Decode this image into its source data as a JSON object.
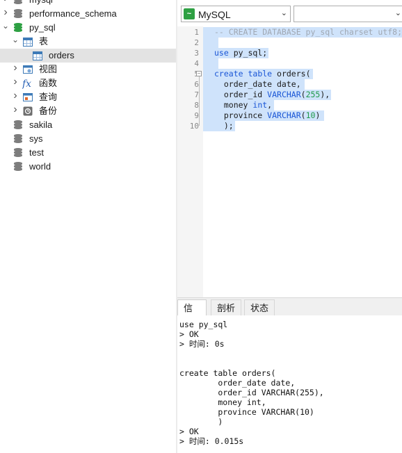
{
  "tree": {
    "items": [
      {
        "label": "mysql",
        "type": "db",
        "level": 1,
        "expanded": false
      },
      {
        "label": "performance_schema",
        "type": "db",
        "level": 1,
        "expanded": false
      },
      {
        "label": "py_sql",
        "type": "db-open",
        "level": 1,
        "expanded": true
      },
      {
        "label": "表",
        "type": "tables",
        "level": 2,
        "expanded": true
      },
      {
        "label": "orders",
        "type": "table",
        "level": 3,
        "selected": true
      },
      {
        "label": "视图",
        "type": "views",
        "level": 2,
        "expanded": false
      },
      {
        "label": "函数",
        "type": "functions",
        "level": 2,
        "expanded": false
      },
      {
        "label": "查询",
        "type": "queries",
        "level": 2,
        "expanded": false
      },
      {
        "label": "备份",
        "type": "backups",
        "level": 2,
        "expanded": false
      },
      {
        "label": "sakila",
        "type": "db",
        "level": 1
      },
      {
        "label": "sys",
        "type": "db",
        "level": 1
      },
      {
        "label": "test",
        "type": "db",
        "level": 1
      },
      {
        "label": "world",
        "type": "db",
        "level": 1
      }
    ]
  },
  "toolbar": {
    "connection": "MySQL",
    "database": ""
  },
  "editor": {
    "line_numbers": [
      "1",
      "2",
      "3",
      "4",
      "5",
      "6",
      "7",
      "8",
      "9",
      "10"
    ],
    "lines": [
      [
        {
          "t": "-- CREATE DATABASE py_sql charset utf8;",
          "c": "cm"
        }
      ],
      [],
      [
        {
          "t": "use",
          "c": "kw"
        },
        {
          "t": " py_sql;",
          "c": "pl"
        }
      ],
      [],
      [
        {
          "t": "create",
          "c": "kw"
        },
        {
          "t": " ",
          "c": "pl"
        },
        {
          "t": "table",
          "c": "kw"
        },
        {
          "t": " orders(",
          "c": "pl"
        }
      ],
      [
        {
          "t": "  order_date date,",
          "c": "pl"
        }
      ],
      [
        {
          "t": "  order_id ",
          "c": "pl"
        },
        {
          "t": "VARCHAR",
          "c": "kw"
        },
        {
          "t": "(",
          "c": "pl"
        },
        {
          "t": "255",
          "c": "num"
        },
        {
          "t": "),",
          "c": "pl"
        }
      ],
      [
        {
          "t": "  money ",
          "c": "pl"
        },
        {
          "t": "int",
          "c": "kw"
        },
        {
          "t": ",",
          "c": "pl"
        }
      ],
      [
        {
          "t": "  province ",
          "c": "pl"
        },
        {
          "t": "VARCHAR",
          "c": "kw"
        },
        {
          "t": "(",
          "c": "pl"
        },
        {
          "t": "10",
          "c": "num"
        },
        {
          "t": ")",
          "c": "pl"
        }
      ],
      [
        {
          "t": "  );",
          "c": "pl"
        }
      ]
    ]
  },
  "tabs": [
    "信息",
    "剖析",
    "状态"
  ],
  "active_tab": "信息",
  "output": {
    "lines": [
      "use py_sql",
      "> OK",
      "> 时间: 0s",
      "",
      "",
      "create table orders(",
      "        order_date date,",
      "        order_id VARCHAR(255),",
      "        money int,",
      "        province VARCHAR(10)",
      "        )",
      "> OK",
      "> 时间: 0.015s"
    ]
  },
  "colors": {
    "keyword": "#1a56d6",
    "number": "#1f9a4a",
    "comment": "#a0a8b3",
    "selection": "#cfe3fb",
    "db_icon": "#7d7d7d",
    "db_icon_open": "#2ea043"
  }
}
